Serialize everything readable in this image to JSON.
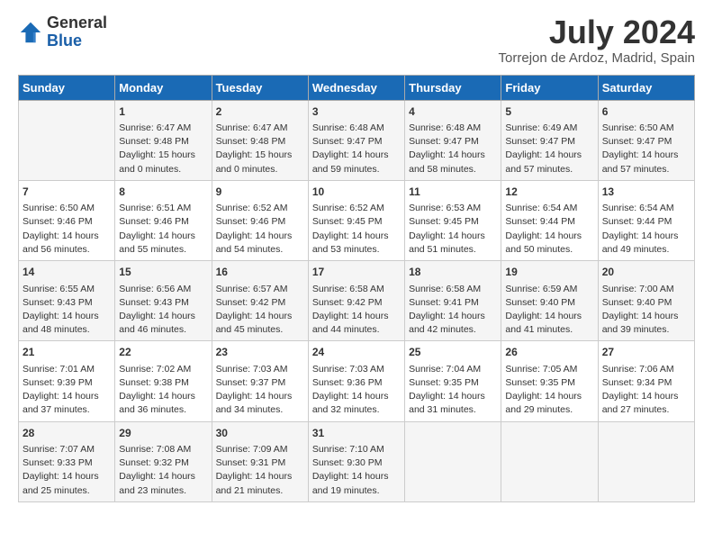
{
  "logo": {
    "general": "General",
    "blue": "Blue"
  },
  "header": {
    "title": "July 2024",
    "subtitle": "Torrejon de Ardoz, Madrid, Spain"
  },
  "days_of_week": [
    "Sunday",
    "Monday",
    "Tuesday",
    "Wednesday",
    "Thursday",
    "Friday",
    "Saturday"
  ],
  "weeks": [
    [
      {
        "day": "",
        "content": ""
      },
      {
        "day": "1",
        "content": "Sunrise: 6:47 AM\nSunset: 9:48 PM\nDaylight: 15 hours\nand 0 minutes."
      },
      {
        "day": "2",
        "content": "Sunrise: 6:47 AM\nSunset: 9:48 PM\nDaylight: 15 hours\nand 0 minutes."
      },
      {
        "day": "3",
        "content": "Sunrise: 6:48 AM\nSunset: 9:47 PM\nDaylight: 14 hours\nand 59 minutes."
      },
      {
        "day": "4",
        "content": "Sunrise: 6:48 AM\nSunset: 9:47 PM\nDaylight: 14 hours\nand 58 minutes."
      },
      {
        "day": "5",
        "content": "Sunrise: 6:49 AM\nSunset: 9:47 PM\nDaylight: 14 hours\nand 57 minutes."
      },
      {
        "day": "6",
        "content": "Sunrise: 6:50 AM\nSunset: 9:47 PM\nDaylight: 14 hours\nand 57 minutes."
      }
    ],
    [
      {
        "day": "7",
        "content": "Sunrise: 6:50 AM\nSunset: 9:46 PM\nDaylight: 14 hours\nand 56 minutes."
      },
      {
        "day": "8",
        "content": "Sunrise: 6:51 AM\nSunset: 9:46 PM\nDaylight: 14 hours\nand 55 minutes."
      },
      {
        "day": "9",
        "content": "Sunrise: 6:52 AM\nSunset: 9:46 PM\nDaylight: 14 hours\nand 54 minutes."
      },
      {
        "day": "10",
        "content": "Sunrise: 6:52 AM\nSunset: 9:45 PM\nDaylight: 14 hours\nand 53 minutes."
      },
      {
        "day": "11",
        "content": "Sunrise: 6:53 AM\nSunset: 9:45 PM\nDaylight: 14 hours\nand 51 minutes."
      },
      {
        "day": "12",
        "content": "Sunrise: 6:54 AM\nSunset: 9:44 PM\nDaylight: 14 hours\nand 50 minutes."
      },
      {
        "day": "13",
        "content": "Sunrise: 6:54 AM\nSunset: 9:44 PM\nDaylight: 14 hours\nand 49 minutes."
      }
    ],
    [
      {
        "day": "14",
        "content": "Sunrise: 6:55 AM\nSunset: 9:43 PM\nDaylight: 14 hours\nand 48 minutes."
      },
      {
        "day": "15",
        "content": "Sunrise: 6:56 AM\nSunset: 9:43 PM\nDaylight: 14 hours\nand 46 minutes."
      },
      {
        "day": "16",
        "content": "Sunrise: 6:57 AM\nSunset: 9:42 PM\nDaylight: 14 hours\nand 45 minutes."
      },
      {
        "day": "17",
        "content": "Sunrise: 6:58 AM\nSunset: 9:42 PM\nDaylight: 14 hours\nand 44 minutes."
      },
      {
        "day": "18",
        "content": "Sunrise: 6:58 AM\nSunset: 9:41 PM\nDaylight: 14 hours\nand 42 minutes."
      },
      {
        "day": "19",
        "content": "Sunrise: 6:59 AM\nSunset: 9:40 PM\nDaylight: 14 hours\nand 41 minutes."
      },
      {
        "day": "20",
        "content": "Sunrise: 7:00 AM\nSunset: 9:40 PM\nDaylight: 14 hours\nand 39 minutes."
      }
    ],
    [
      {
        "day": "21",
        "content": "Sunrise: 7:01 AM\nSunset: 9:39 PM\nDaylight: 14 hours\nand 37 minutes."
      },
      {
        "day": "22",
        "content": "Sunrise: 7:02 AM\nSunset: 9:38 PM\nDaylight: 14 hours\nand 36 minutes."
      },
      {
        "day": "23",
        "content": "Sunrise: 7:03 AM\nSunset: 9:37 PM\nDaylight: 14 hours\nand 34 minutes."
      },
      {
        "day": "24",
        "content": "Sunrise: 7:03 AM\nSunset: 9:36 PM\nDaylight: 14 hours\nand 32 minutes."
      },
      {
        "day": "25",
        "content": "Sunrise: 7:04 AM\nSunset: 9:35 PM\nDaylight: 14 hours\nand 31 minutes."
      },
      {
        "day": "26",
        "content": "Sunrise: 7:05 AM\nSunset: 9:35 PM\nDaylight: 14 hours\nand 29 minutes."
      },
      {
        "day": "27",
        "content": "Sunrise: 7:06 AM\nSunset: 9:34 PM\nDaylight: 14 hours\nand 27 minutes."
      }
    ],
    [
      {
        "day": "28",
        "content": "Sunrise: 7:07 AM\nSunset: 9:33 PM\nDaylight: 14 hours\nand 25 minutes."
      },
      {
        "day": "29",
        "content": "Sunrise: 7:08 AM\nSunset: 9:32 PM\nDaylight: 14 hours\nand 23 minutes."
      },
      {
        "day": "30",
        "content": "Sunrise: 7:09 AM\nSunset: 9:31 PM\nDaylight: 14 hours\nand 21 minutes."
      },
      {
        "day": "31",
        "content": "Sunrise: 7:10 AM\nSunset: 9:30 PM\nDaylight: 14 hours\nand 19 minutes."
      },
      {
        "day": "",
        "content": ""
      },
      {
        "day": "",
        "content": ""
      },
      {
        "day": "",
        "content": ""
      }
    ]
  ]
}
